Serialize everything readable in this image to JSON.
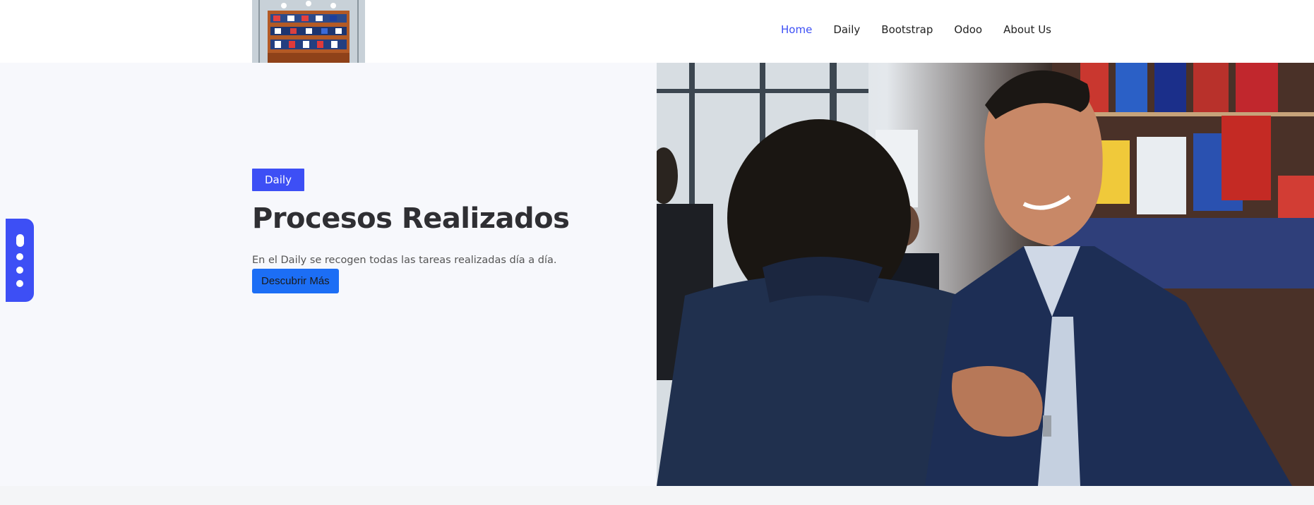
{
  "nav": {
    "items": [
      {
        "label": "Home",
        "active": true
      },
      {
        "label": "Daily",
        "active": false
      },
      {
        "label": "Bootstrap",
        "active": false
      },
      {
        "label": "Odoo",
        "active": false
      },
      {
        "label": "About Us",
        "active": false
      }
    ]
  },
  "hero": {
    "badge": "Daily",
    "title": "Procesos Realizados",
    "description": "En el Daily se recogen todas las tareas realizadas día a día.",
    "cta_label": "Descubrir Más"
  },
  "icons": {
    "side_widget": "vertical-dots-icon",
    "logo": "store-shelves-image",
    "hero_image": "handshake-photo"
  },
  "colors": {
    "accent": "#3d4ff5",
    "cta": "#1c6ef5",
    "nav_active": "#3d4ff5",
    "text_dark": "#2f2f33"
  }
}
